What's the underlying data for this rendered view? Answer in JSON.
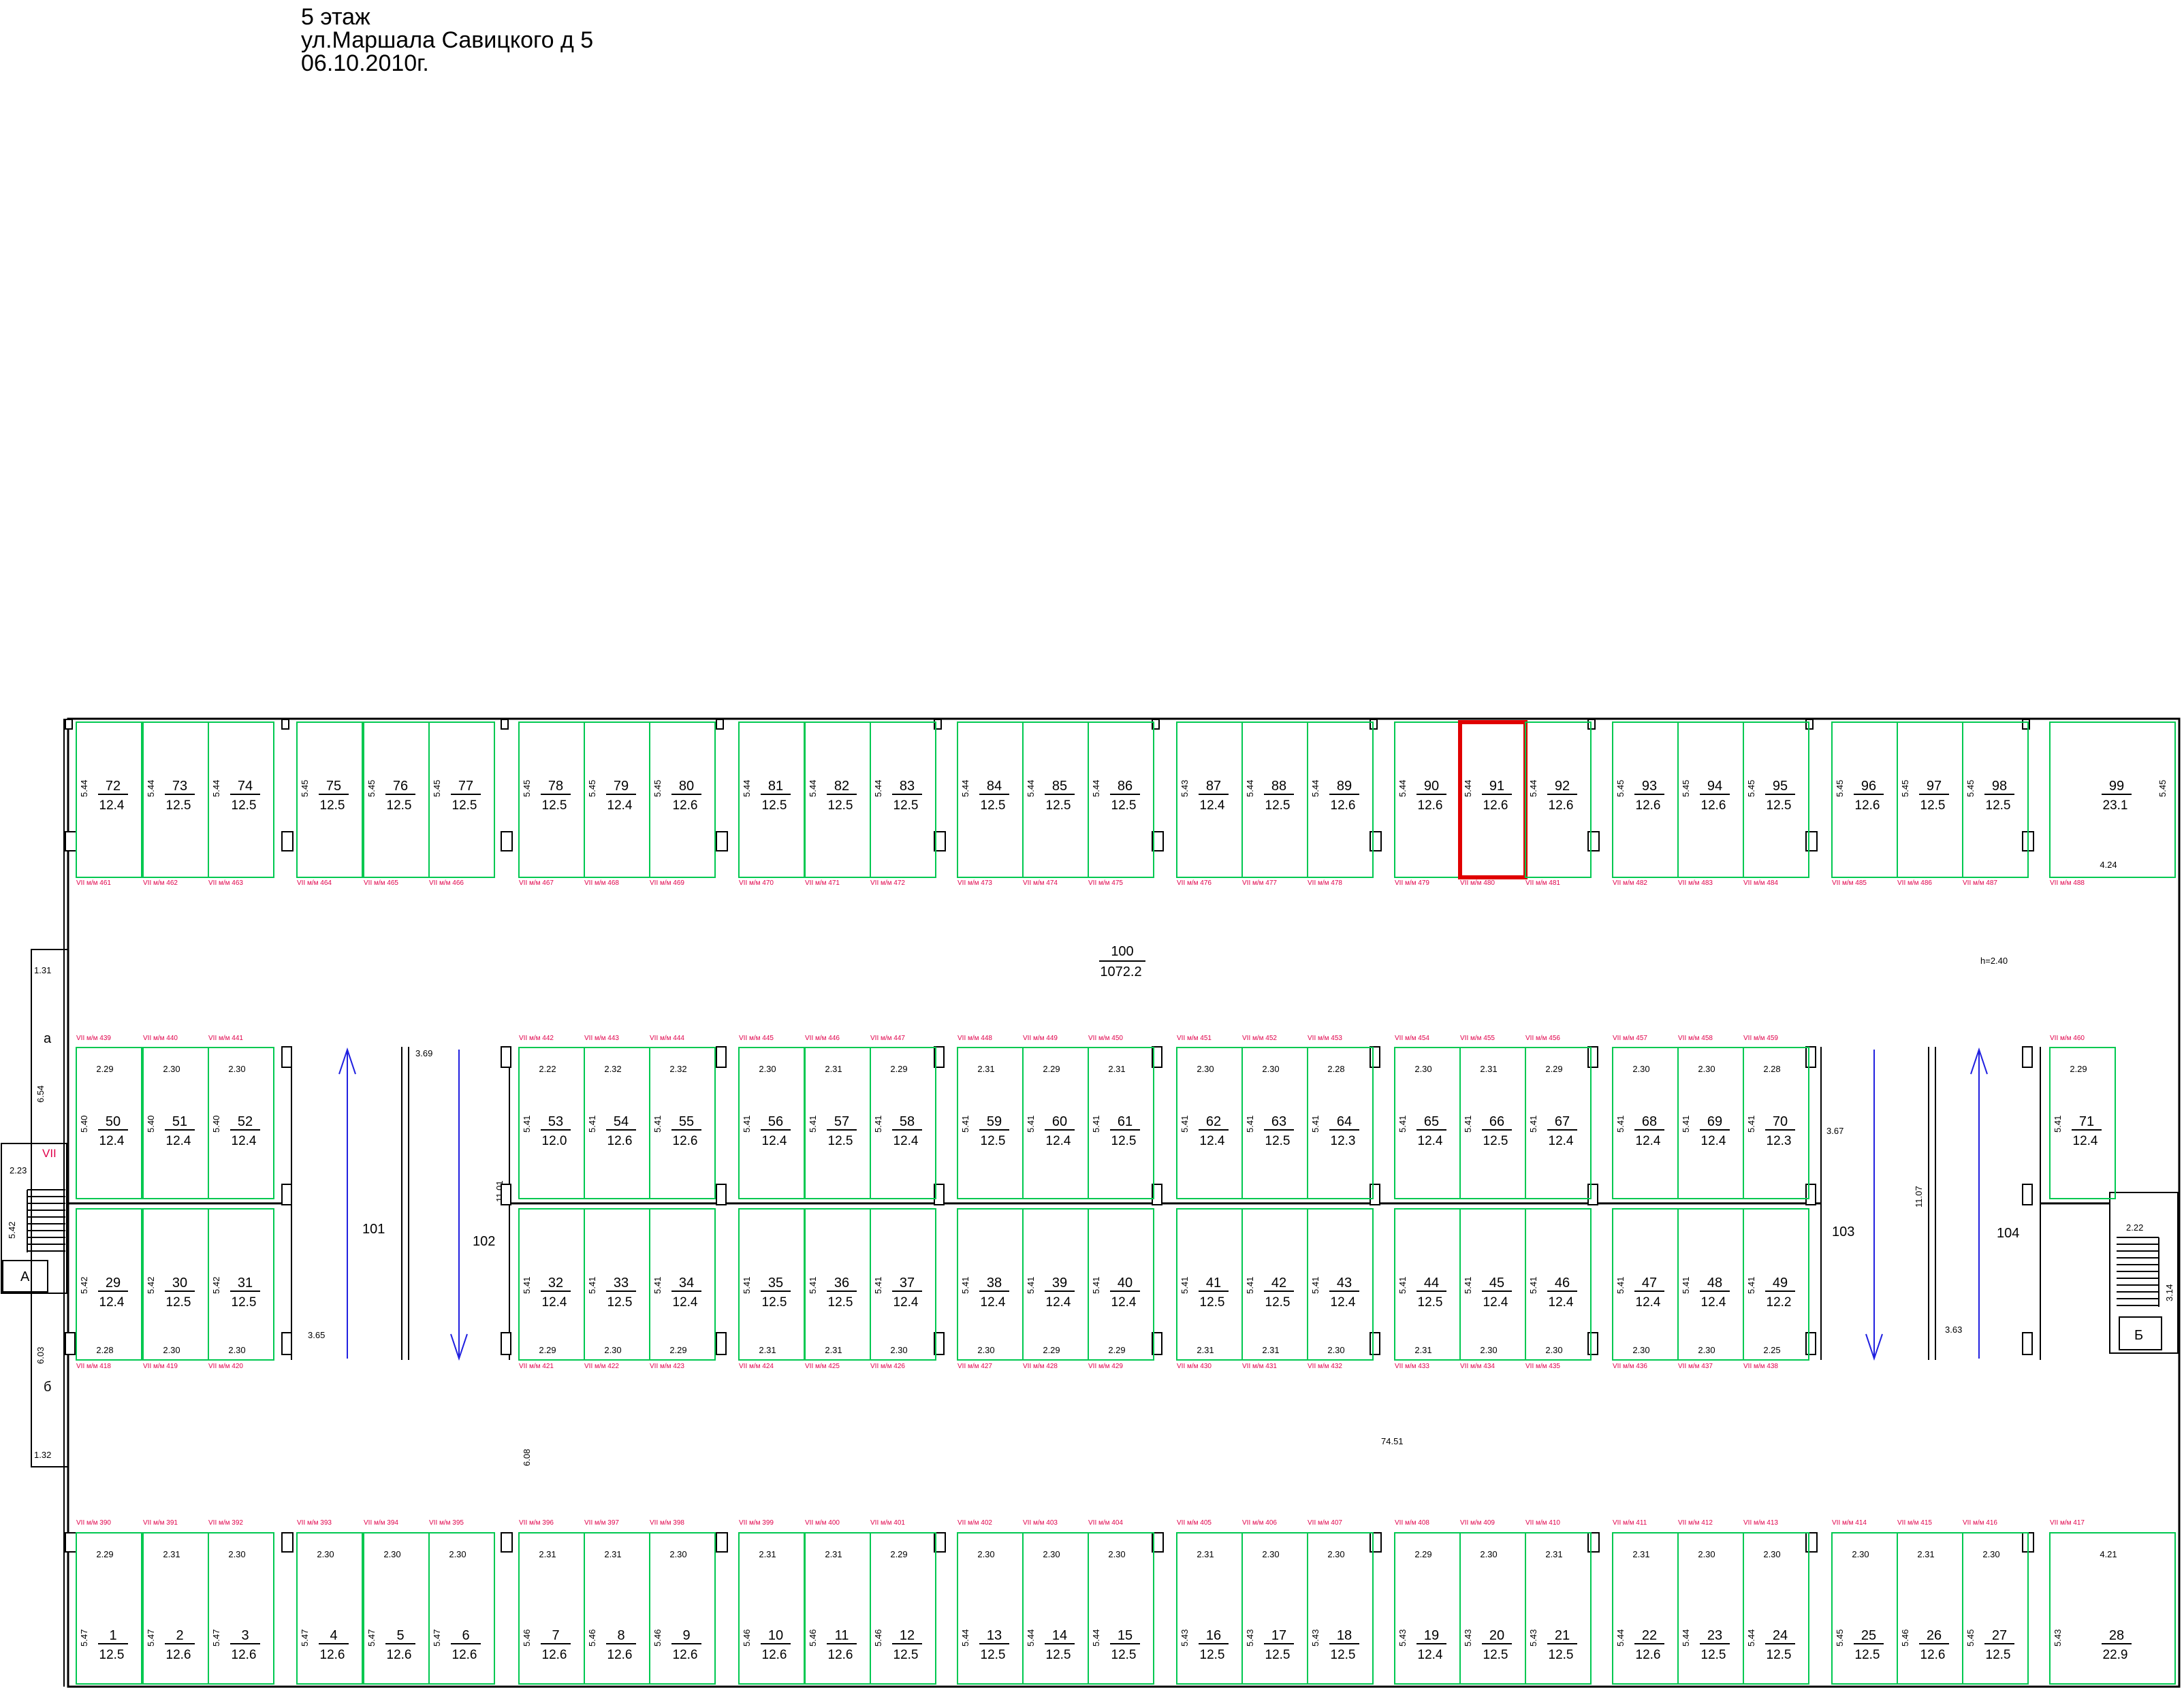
{
  "header": {
    "floor": "5 этаж",
    "address": "ул.Маршала Савицкого д 5",
    "date": "06.10.2010г."
  },
  "hall": {
    "number": "100",
    "area": "1072.2",
    "height": "h=2.40",
    "length": "74.51"
  },
  "stair_left": {
    "roman": "VII",
    "letter": "A",
    "width": "2.23",
    "depth": "5.42",
    "dims": [
      "1.31",
      "6.54",
      "6.03",
      "1.32"
    ],
    "sides": [
      "а",
      "б"
    ]
  },
  "stair_right": {
    "letter": "Б",
    "width": "2.22",
    "depth": "3.14"
  },
  "ramps": [
    {
      "number": "101",
      "dim": "3.65"
    },
    {
      "number": "102",
      "dim": "3.69",
      "length": "11.01"
    },
    {
      "number": "103",
      "dim": "3.67"
    },
    {
      "number": "104",
      "dim": "3.63",
      "length": "11.07"
    }
  ],
  "misc_dims": {
    "corridor_gap": "6.08"
  },
  "highlighted": "91",
  "cells": [
    {
      "n": "72",
      "a": "12.4",
      "d": "5.44",
      "l": "VII м/м 461",
      "r": 0,
      "c": 0
    },
    {
      "n": "73",
      "a": "12.5",
      "d": "5.44",
      "l": "VII м/м 462",
      "r": 0,
      "c": 1
    },
    {
      "n": "74",
      "a": "12.5",
      "d": "5.44",
      "l": "VII м/м 463",
      "r": 0,
      "c": 2
    },
    {
      "n": "75",
      "a": "12.5",
      "d": "5.45",
      "l": "VII м/м 464",
      "r": 0,
      "c": 3
    },
    {
      "n": "76",
      "a": "12.5",
      "d": "5.45",
      "l": "VII м/м 465",
      "r": 0,
      "c": 4
    },
    {
      "n": "77",
      "a": "12.5",
      "d": "5.45",
      "l": "VII м/м 466",
      "r": 0,
      "c": 5
    },
    {
      "n": "78",
      "a": "12.5",
      "d": "5.45",
      "l": "VII м/м 467",
      "r": 0,
      "c": 6
    },
    {
      "n": "79",
      "a": "12.4",
      "d": "5.45",
      "l": "VII м/м 468",
      "r": 0,
      "c": 7
    },
    {
      "n": "80",
      "a": "12.6",
      "d": "5.45",
      "l": "VII м/м 469",
      "r": 0,
      "c": 8
    },
    {
      "n": "81",
      "a": "12.5",
      "d": "5.44",
      "l": "VII м/м 470",
      "r": 0,
      "c": 9
    },
    {
      "n": "82",
      "a": "12.5",
      "d": "5.44",
      "l": "VII м/м 471",
      "r": 0,
      "c": 10
    },
    {
      "n": "83",
      "a": "12.5",
      "d": "5.44",
      "l": "VII м/м 472",
      "r": 0,
      "c": 11
    },
    {
      "n": "84",
      "a": "12.5",
      "d": "5.44",
      "l": "VII м/м 473",
      "r": 0,
      "c": 12
    },
    {
      "n": "85",
      "a": "12.5",
      "d": "5.44",
      "l": "VII м/м 474",
      "r": 0,
      "c": 13
    },
    {
      "n": "86",
      "a": "12.5",
      "d": "5.44",
      "l": "VII м/м 475",
      "r": 0,
      "c": 14
    },
    {
      "n": "87",
      "a": "12.4",
      "d": "5.43",
      "l": "VII м/м 476",
      "r": 0,
      "c": 15
    },
    {
      "n": "88",
      "a": "12.5",
      "d": "5.44",
      "l": "VII м/м 477",
      "r": 0,
      "c": 16
    },
    {
      "n": "89",
      "a": "12.6",
      "d": "5.44",
      "l": "VII м/м 478",
      "r": 0,
      "c": 17
    },
    {
      "n": "90",
      "a": "12.6",
      "d": "5.44",
      "l": "VII м/м 479",
      "r": 0,
      "c": 18
    },
    {
      "n": "91",
      "a": "12.6",
      "d": "5.44",
      "l": "VII м/м 480",
      "r": 0,
      "c": 19
    },
    {
      "n": "92",
      "a": "12.6",
      "d": "5.44",
      "l": "VII м/м 481",
      "r": 0,
      "c": 20
    },
    {
      "n": "93",
      "a": "12.6",
      "d": "5.45",
      "l": "VII м/м 482",
      "r": 0,
      "c": 21
    },
    {
      "n": "94",
      "a": "12.6",
      "d": "5.45",
      "l": "VII м/м 483",
      "r": 0,
      "c": 22
    },
    {
      "n": "95",
      "a": "12.5",
      "d": "5.45",
      "l": "VII м/м 484",
      "r": 0,
      "c": 23
    },
    {
      "n": "96",
      "a": "12.6",
      "d": "5.45",
      "l": "VII м/м 485",
      "r": 0,
      "c": 24
    },
    {
      "n": "97",
      "a": "12.5",
      "d": "5.45",
      "l": "VII м/м 486",
      "r": 0,
      "c": 25
    },
    {
      "n": "98",
      "a": "12.5",
      "d": "5.45",
      "l": "VII м/м 487",
      "r": 0,
      "c": 26
    },
    {
      "n": "99",
      "a": "23.1",
      "d": "5.45",
      "w": "4.24",
      "l": "VII м/м 488",
      "r": 0,
      "c": 27
    },
    {
      "n": "50",
      "a": "12.4",
      "d": "5.40",
      "w": "2.29",
      "l": "VII м/м 439",
      "r": 1,
      "c": 0
    },
    {
      "n": "51",
      "a": "12.4",
      "d": "5.40",
      "w": "2.30",
      "l": "VII м/м 440",
      "r": 1,
      "c": 1
    },
    {
      "n": "52",
      "a": "12.4",
      "d": "5.40",
      "w": "2.30",
      "l": "VII м/м 441",
      "r": 1,
      "c": 2
    },
    {
      "n": "53",
      "a": "12.0",
      "d": "5.41",
      "w": "2.22",
      "l": "VII м/м 442",
      "r": 1,
      "c": 6
    },
    {
      "n": "54",
      "a": "12.6",
      "d": "5.41",
      "w": "2.32",
      "l": "VII м/м 443",
      "r": 1,
      "c": 7
    },
    {
      "n": "55",
      "a": "12.6",
      "d": "5.41",
      "w": "2.32",
      "l": "VII м/м 444",
      "r": 1,
      "c": 8
    },
    {
      "n": "56",
      "a": "12.4",
      "d": "5.41",
      "w": "2.30",
      "l": "VII м/м 445",
      "r": 1,
      "c": 9
    },
    {
      "n": "57",
      "a": "12.5",
      "d": "5.41",
      "w": "2.31",
      "l": "VII м/м 446",
      "r": 1,
      "c": 10
    },
    {
      "n": "58",
      "a": "12.4",
      "d": "5.41",
      "w": "2.29",
      "l": "VII м/м 447",
      "r": 1,
      "c": 11
    },
    {
      "n": "59",
      "a": "12.5",
      "d": "5.41",
      "w": "2.31",
      "l": "VII м/м 448",
      "r": 1,
      "c": 12
    },
    {
      "n": "60",
      "a": "12.4",
      "d": "5.41",
      "w": "2.29",
      "l": "VII м/м 449",
      "r": 1,
      "c": 13
    },
    {
      "n": "61",
      "a": "12.5",
      "d": "5.41",
      "w": "2.31",
      "l": "VII м/м 450",
      "r": 1,
      "c": 14
    },
    {
      "n": "62",
      "a": "12.4",
      "d": "5.41",
      "w": "2.30",
      "l": "VII м/м 451",
      "r": 1,
      "c": 15
    },
    {
      "n": "63",
      "a": "12.5",
      "d": "5.41",
      "w": "2.30",
      "l": "VII м/м 452",
      "r": 1,
      "c": 16
    },
    {
      "n": "64",
      "a": "12.3",
      "d": "5.41",
      "w": "2.28",
      "l": "VII м/м 453",
      "r": 1,
      "c": 17
    },
    {
      "n": "65",
      "a": "12.4",
      "d": "5.41",
      "w": "2.30",
      "l": "VII м/м 454",
      "r": 1,
      "c": 18
    },
    {
      "n": "66",
      "a": "12.5",
      "d": "5.41",
      "w": "2.31",
      "l": "VII м/м 455",
      "r": 1,
      "c": 19
    },
    {
      "n": "67",
      "a": "12.4",
      "d": "5.41",
      "w": "2.29",
      "l": "VII м/м 456",
      "r": 1,
      "c": 20
    },
    {
      "n": "68",
      "a": "12.4",
      "d": "5.41",
      "w": "2.30",
      "l": "VII м/м 457",
      "r": 1,
      "c": 21
    },
    {
      "n": "69",
      "a": "12.4",
      "d": "5.41",
      "w": "2.30",
      "l": "VII м/м 458",
      "r": 1,
      "c": 22
    },
    {
      "n": "70",
      "a": "12.3",
      "d": "5.41",
      "w": "2.28",
      "l": "VII м/м 459",
      "r": 1,
      "c": 23
    },
    {
      "n": "71",
      "a": "12.4",
      "d": "5.41",
      "w": "2.29",
      "l": "VII м/м 460",
      "r": 1,
      "c": 27
    },
    {
      "n": "29",
      "a": "12.4",
      "d": "5.42",
      "w": "2.28",
      "l": "VII м/м 418",
      "r": 2,
      "c": 0
    },
    {
      "n": "30",
      "a": "12.5",
      "d": "5.42",
      "w": "2.30",
      "l": "VII м/м 419",
      "r": 2,
      "c": 1
    },
    {
      "n": "31",
      "a": "12.5",
      "d": "5.42",
      "w": "2.30",
      "l": "VII м/м 420",
      "r": 2,
      "c": 2
    },
    {
      "n": "32",
      "a": "12.4",
      "d": "5.41",
      "w": "2.29",
      "l": "VII м/м 421",
      "r": 2,
      "c": 6
    },
    {
      "n": "33",
      "a": "12.5",
      "d": "5.41",
      "w": "2.30",
      "l": "VII м/м 422",
      "r": 2,
      "c": 7
    },
    {
      "n": "34",
      "a": "12.4",
      "d": "5.41",
      "w": "2.29",
      "l": "VII м/м 423",
      "r": 2,
      "c": 8
    },
    {
      "n": "35",
      "a": "12.5",
      "d": "5.41",
      "w": "2.31",
      "l": "VII м/м 424",
      "r": 2,
      "c": 9
    },
    {
      "n": "36",
      "a": "12.5",
      "d": "5.41",
      "w": "2.31",
      "l": "VII м/м 425",
      "r": 2,
      "c": 10
    },
    {
      "n": "37",
      "a": "12.4",
      "d": "5.41",
      "w": "2.30",
      "l": "VII м/м 426",
      "r": 2,
      "c": 11
    },
    {
      "n": "38",
      "a": "12.4",
      "d": "5.41",
      "w": "2.30",
      "l": "VII м/м 427",
      "r": 2,
      "c": 12
    },
    {
      "n": "39",
      "a": "12.4",
      "d": "5.41",
      "w": "2.29",
      "l": "VII м/м 428",
      "r": 2,
      "c": 13
    },
    {
      "n": "40",
      "a": "12.4",
      "d": "5.41",
      "w": "2.29",
      "l": "VII м/м 429",
      "r": 2,
      "c": 14
    },
    {
      "n": "41",
      "a": "12.5",
      "d": "5.41",
      "w": "2.31",
      "l": "VII м/м 430",
      "r": 2,
      "c": 15
    },
    {
      "n": "42",
      "a": "12.5",
      "d": "5.41",
      "w": "2.31",
      "l": "VII м/м 431",
      "r": 2,
      "c": 16
    },
    {
      "n": "43",
      "a": "12.4",
      "d": "5.41",
      "w": "2.30",
      "l": "VII м/м 432",
      "r": 2,
      "c": 17
    },
    {
      "n": "44",
      "a": "12.5",
      "d": "5.41",
      "w": "2.31",
      "l": "VII м/м 433",
      "r": 2,
      "c": 18
    },
    {
      "n": "45",
      "a": "12.4",
      "d": "5.41",
      "w": "2.30",
      "l": "VII м/м 434",
      "r": 2,
      "c": 19
    },
    {
      "n": "46",
      "a": "12.4",
      "d": "5.41",
      "w": "2.30",
      "l": "VII м/м 435",
      "r": 2,
      "c": 20
    },
    {
      "n": "47",
      "a": "12.4",
      "d": "5.41",
      "w": "2.30",
      "l": "VII м/м 436",
      "r": 2,
      "c": 21
    },
    {
      "n": "48",
      "a": "12.4",
      "d": "5.41",
      "w": "2.30",
      "l": "VII м/м 437",
      "r": 2,
      "c": 22
    },
    {
      "n": "49",
      "a": "12.2",
      "d": "5.41",
      "w": "2.25",
      "l": "VII м/м 438",
      "r": 2,
      "c": 23
    },
    {
      "n": "1",
      "a": "12.5",
      "d": "5.47",
      "w": "2.29",
      "l": "VII м/м 390",
      "r": 3,
      "c": 0
    },
    {
      "n": "2",
      "a": "12.6",
      "d": "5.47",
      "w": "2.31",
      "l": "VII м/м 391",
      "r": 3,
      "c": 1
    },
    {
      "n": "3",
      "a": "12.6",
      "d": "5.47",
      "w": "2.30",
      "l": "VII м/м 392",
      "r": 3,
      "c": 2
    },
    {
      "n": "4",
      "a": "12.6",
      "d": "5.47",
      "w": "2.30",
      "l": "VII м/м 393",
      "r": 3,
      "c": 3
    },
    {
      "n": "5",
      "a": "12.6",
      "d": "5.47",
      "w": "2.30",
      "l": "VII м/м 394",
      "r": 3,
      "c": 4
    },
    {
      "n": "6",
      "a": "12.6",
      "d": "5.47",
      "w": "2.30",
      "l": "VII м/м 395",
      "r": 3,
      "c": 5
    },
    {
      "n": "7",
      "a": "12.6",
      "d": "5.46",
      "w": "2.31",
      "l": "VII м/м 396",
      "r": 3,
      "c": 6
    },
    {
      "n": "8",
      "a": "12.6",
      "d": "5.46",
      "w": "2.31",
      "l": "VII м/м 397",
      "r": 3,
      "c": 7
    },
    {
      "n": "9",
      "a": "12.6",
      "d": "5.46",
      "w": "2.30",
      "l": "VII м/м 398",
      "r": 3,
      "c": 8
    },
    {
      "n": "10",
      "a": "12.6",
      "d": "5.46",
      "w": "2.31",
      "l": "VII м/м 399",
      "r": 3,
      "c": 9
    },
    {
      "n": "11",
      "a": "12.6",
      "d": "5.46",
      "w": "2.31",
      "l": "VII м/м 400",
      "r": 3,
      "c": 10
    },
    {
      "n": "12",
      "a": "12.5",
      "d": "5.46",
      "w": "2.29",
      "l": "VII м/м 401",
      "r": 3,
      "c": 11
    },
    {
      "n": "13",
      "a": "12.5",
      "d": "5.44",
      "w": "2.30",
      "l": "VII м/м 402",
      "r": 3,
      "c": 12
    },
    {
      "n": "14",
      "a": "12.5",
      "d": "5.44",
      "w": "2.30",
      "l": "VII м/м 403",
      "r": 3,
      "c": 13
    },
    {
      "n": "15",
      "a": "12.5",
      "d": "5.44",
      "w": "2.30",
      "l": "VII м/м 404",
      "r": 3,
      "c": 14
    },
    {
      "n": "16",
      "a": "12.5",
      "d": "5.43",
      "w": "2.31",
      "l": "VII м/м 405",
      "r": 3,
      "c": 15
    },
    {
      "n": "17",
      "a": "12.5",
      "d": "5.43",
      "w": "2.30",
      "l": "VII м/м 406",
      "r": 3,
      "c": 16
    },
    {
      "n": "18",
      "a": "12.5",
      "d": "5.43",
      "w": "2.30",
      "l": "VII м/м 407",
      "r": 3,
      "c": 17
    },
    {
      "n": "19",
      "a": "12.4",
      "d": "5.43",
      "w": "2.29",
      "l": "VII м/м 408",
      "r": 3,
      "c": 18
    },
    {
      "n": "20",
      "a": "12.5",
      "d": "5.43",
      "w": "2.30",
      "l": "VII м/м 409",
      "r": 3,
      "c": 19
    },
    {
      "n": "21",
      "a": "12.5",
      "d": "5.43",
      "w": "2.31",
      "l": "VII м/м 410",
      "r": 3,
      "c": 20
    },
    {
      "n": "22",
      "a": "12.6",
      "d": "5.44",
      "w": "2.31",
      "l": "VII м/м 411",
      "r": 3,
      "c": 21
    },
    {
      "n": "23",
      "a": "12.5",
      "d": "5.44",
      "w": "2.30",
      "l": "VII м/м 412",
      "r": 3,
      "c": 22
    },
    {
      "n": "24",
      "a": "12.5",
      "d": "5.44",
      "w": "2.30",
      "l": "VII м/м 413",
      "r": 3,
      "c": 23
    },
    {
      "n": "25",
      "a": "12.5",
      "d": "5.45",
      "w": "2.30",
      "l": "VII м/м 414",
      "r": 3,
      "c": 24
    },
    {
      "n": "26",
      "a": "12.6",
      "d": "5.46",
      "w": "2.31",
      "l": "VII м/м 415",
      "r": 3,
      "c": 25
    },
    {
      "n": "27",
      "a": "12.5",
      "d": "5.45",
      "w": "2.30",
      "l": "VII м/м 416",
      "r": 3,
      "c": 26
    },
    {
      "n": "28",
      "a": "22.9",
      "d": "5.43",
      "w": "4.21",
      "l": "VII м/м 417",
      "r": 3,
      "c": 27
    }
  ]
}
